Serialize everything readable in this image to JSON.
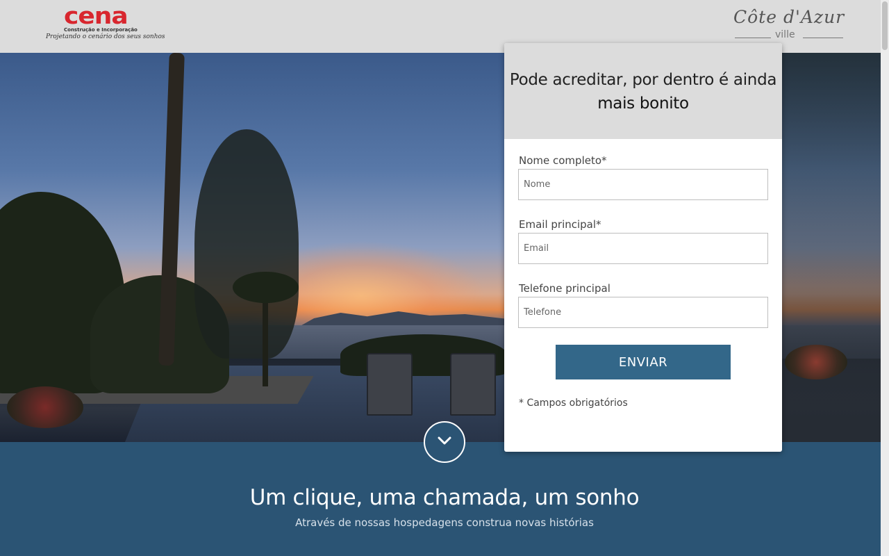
{
  "header": {
    "brand_left": {
      "name": "cena",
      "subtitle": "Construção e Incorporação",
      "tagline": "Projetando o cenário dos seus sonhos"
    },
    "brand_right": {
      "name": "Côte d'Azur",
      "sub": "ville"
    }
  },
  "form": {
    "title_line1": "Pode acreditar, por dentro é ainda",
    "title_line2": "mais bonito",
    "fields": [
      {
        "label": "Nome completo*",
        "placeholder": "Nome"
      },
      {
        "label": "Email principal*",
        "placeholder": "Email"
      },
      {
        "label": "Telefone principal",
        "placeholder": "Telefone"
      }
    ],
    "submit_label": "ENVIAR",
    "required_note": "* Campos obrigatórios"
  },
  "scroll_icon": "chevron-down-icon",
  "band": {
    "title": "Um clique, uma chamada, um sonho",
    "subtitle": "Através de nossas hospedagens construa novas histórias"
  },
  "colors": {
    "brand_red": "#d8262e",
    "primary_blue": "#336789",
    "band_blue": "#2b5474",
    "header_gray": "#dcdcdc"
  }
}
